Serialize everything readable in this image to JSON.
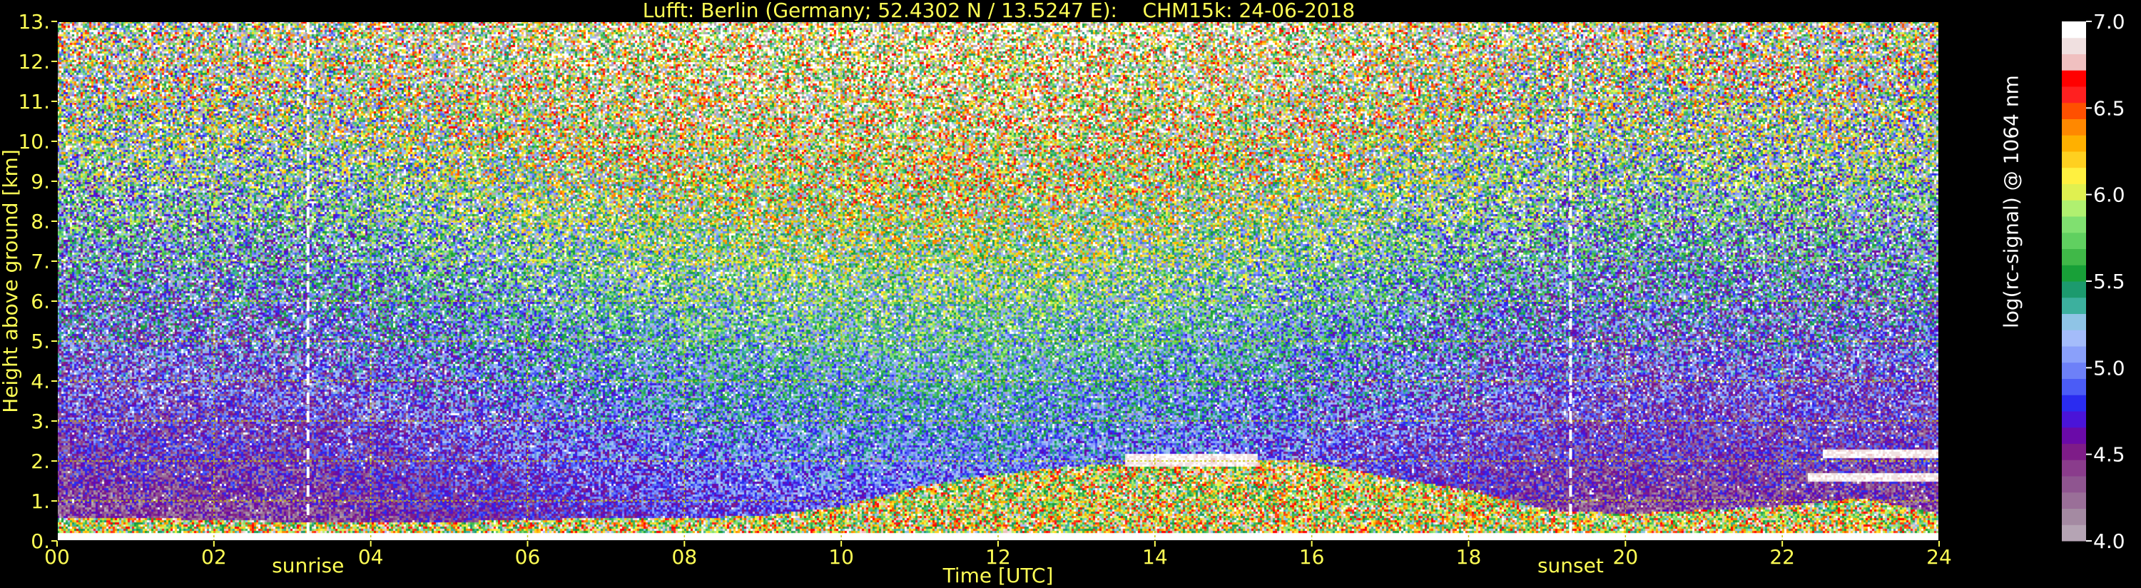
{
  "title": "Lufft: Berlin (Germany; 52.4302 N / 13.5247 E):    CHM15k: 24-06-2018",
  "colors": {
    "background": "#000000",
    "text": "#ffff55",
    "grid": "#c8c800",
    "marker": "#ffffff"
  },
  "chart_data": {
    "type": "heatmap",
    "title": "Lufft: Berlin (Germany; 52.4302 N / 13.5247 E):    CHM15k: 24-06-2018",
    "xlabel": "Time [UTC]",
    "ylabel": "Height above ground [km]",
    "xlim": [
      0,
      24
    ],
    "ylim": [
      0,
      13
    ],
    "x_ticks": [
      "00",
      "02",
      "04",
      "06",
      "08",
      "10",
      "12",
      "14",
      "16",
      "18",
      "20",
      "22",
      "24"
    ],
    "y_ticks": [
      "0.",
      "1.",
      "2.",
      "3.",
      "4.",
      "5.",
      "6.",
      "7.",
      "8.",
      "9.",
      "10.",
      "11.",
      "12.",
      "13."
    ],
    "grid": true,
    "markers": [
      {
        "label": "sunrise",
        "time": 3.2
      },
      {
        "label": "sunset",
        "time": 19.3
      }
    ],
    "colorbar": {
      "label": "log(rc-signal) @ 1064 nm",
      "range": [
        4.0,
        7.0
      ],
      "ticks": [
        "4.0",
        "4.5",
        "5.0",
        "5.5",
        "6.0",
        "6.5",
        "7.0"
      ],
      "colors": [
        "#b5a4b4",
        "#a48aa2",
        "#9a6f98",
        "#8f5590",
        "#8a3c8c",
        "#7e1c88",
        "#6a0aa8",
        "#4a14d8",
        "#2a2cf0",
        "#4b5cf6",
        "#6d80f8",
        "#8aa0fa",
        "#a4bcfa",
        "#8fc4e6",
        "#3cb09e",
        "#1c9a6e",
        "#18a038",
        "#40b848",
        "#60d060",
        "#80e070",
        "#b0f070",
        "#e0f050",
        "#fff040",
        "#ffd020",
        "#ffb000",
        "#ff8800",
        "#ff5000",
        "#ff2020",
        "#ff0000",
        "#f0c0c0",
        "#f0e0e0",
        "#ffffff"
      ]
    },
    "boundary_layer_top_km": [
      0.6,
      0.6,
      0.55,
      0.5,
      0.5,
      0.5,
      0.55,
      0.6,
      0.6,
      0.65,
      0.9,
      1.4,
      1.7,
      1.9,
      2.0,
      2.1,
      2.0,
      1.6,
      1.3,
      0.8,
      0.7,
      0.8,
      0.9,
      1.1,
      0.7
    ],
    "clouds": [
      {
        "start": 13.6,
        "end": 15.3,
        "base_km": 1.9,
        "top_km": 2.2
      },
      {
        "start": 22.5,
        "end": 24.0,
        "base_km": 2.1,
        "top_km": 2.3
      },
      {
        "start": 22.3,
        "end": 24.0,
        "base_km": 1.5,
        "top_km": 1.7
      }
    ]
  }
}
